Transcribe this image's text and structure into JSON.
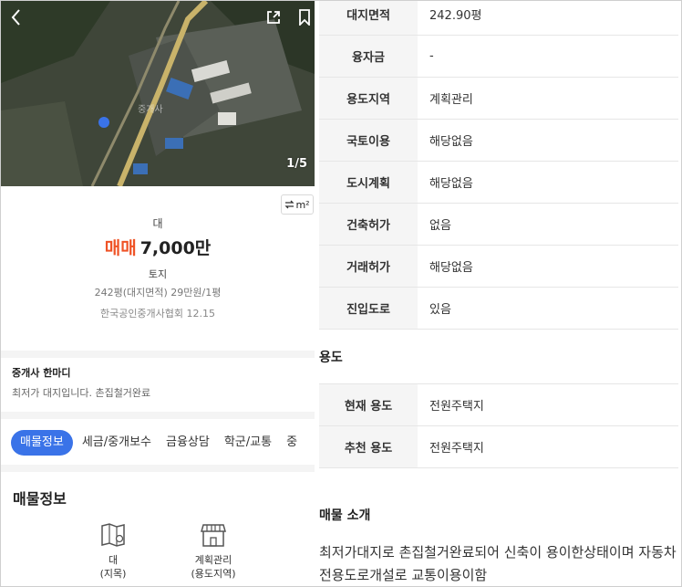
{
  "header": {
    "back_icon": "chevron-left-icon",
    "share_icon": "share-icon",
    "bookmark_icon": "bookmark-icon",
    "photo_counter": "1/5"
  },
  "unit_toggle": {
    "label": "m²",
    "icon": "swap-icon"
  },
  "summary": {
    "land_type": "대",
    "deal_type": "매매",
    "price": "7,000만",
    "category": "토지",
    "area_info": "242평(대지면적)  29만원/1평",
    "agency_info": "한국공인중개사협회 12.15"
  },
  "agent": {
    "title": "중개사 한마디",
    "message": "최저가 대지입니다. 촌집철거완료"
  },
  "tabs": [
    {
      "label": "매물정보"
    },
    {
      "label": "세금/중개보수"
    },
    {
      "label": "금융상담"
    },
    {
      "label": "학군/교통"
    },
    {
      "label": "중"
    }
  ],
  "listing_section": {
    "title": "매물정보",
    "features": [
      {
        "icon": "land-map-icon",
        "line1": "대",
        "line2": "(지목)"
      },
      {
        "icon": "store-icon",
        "line1": "계획관리",
        "line2": "(용도지역)"
      }
    ]
  },
  "info_table": [
    {
      "label": "대지면적",
      "value": "242.90평"
    },
    {
      "label": "융자금",
      "value": "-"
    },
    {
      "label": "용도지역",
      "value": "계획관리"
    },
    {
      "label": "국토이용",
      "value": "해당없음"
    },
    {
      "label": "도시계획",
      "value": "해당없음"
    },
    {
      "label": "건축허가",
      "value": "없음"
    },
    {
      "label": "거래허가",
      "value": "해당없음"
    },
    {
      "label": "진입도로",
      "value": "있음"
    }
  ],
  "usage": {
    "title": "용도",
    "rows": [
      {
        "label": "현재 용도",
        "value": "전원주택지"
      },
      {
        "label": "추천 용도",
        "value": "전원주택지"
      }
    ]
  },
  "intro": {
    "title": "매물 소개",
    "text": "최저가대지로 촌집철거완료되어 신축이 용이한상태이며 자동차전용도로개설로 교통이용이함"
  },
  "colors": {
    "deal_accent": "#ef5326",
    "tab_active": "#3a73e8",
    "table_label_bg": "#f5f5f5"
  }
}
